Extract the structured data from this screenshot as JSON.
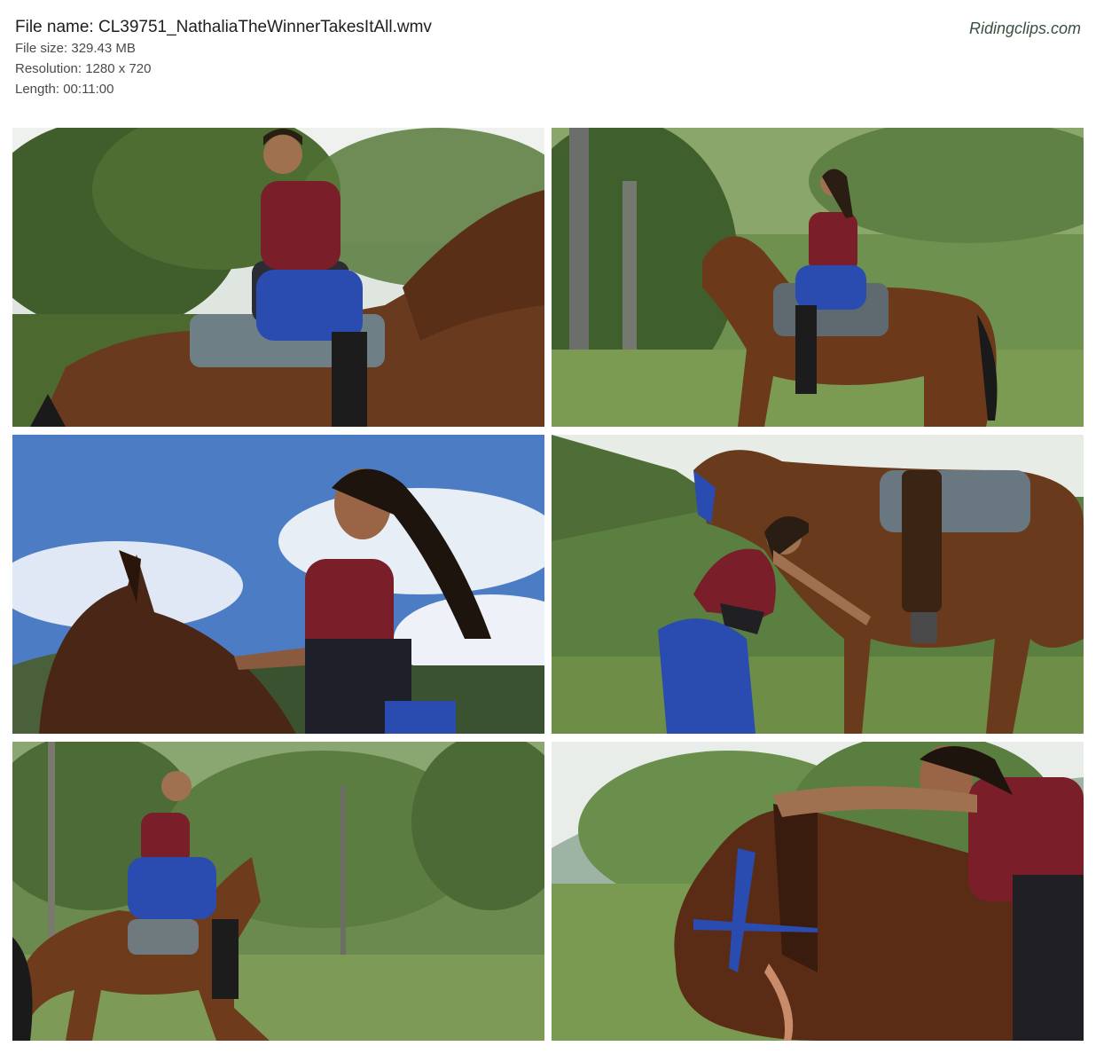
{
  "header": {
    "file_name": "File name: CL39751_NathaliaTheWinnerTakesItAll.wmv",
    "file_size": "File size: 329.43 MB",
    "resolution": "Resolution: 1280 x 720",
    "length": "Length: 00:11:00",
    "brand": "Ridingclips.com"
  },
  "thumbnails": [
    {
      "index": 1,
      "scene": "rider-on-horse-under-trees"
    },
    {
      "index": 2,
      "scene": "rider-on-horse-in-field"
    },
    {
      "index": 3,
      "scene": "rider-against-blue-sky"
    },
    {
      "index": 4,
      "scene": "woman-beside-saddled-horse"
    },
    {
      "index": 5,
      "scene": "rider-galloping-by-forest"
    },
    {
      "index": 6,
      "scene": "rider-leaning-on-horse-neck"
    }
  ]
}
